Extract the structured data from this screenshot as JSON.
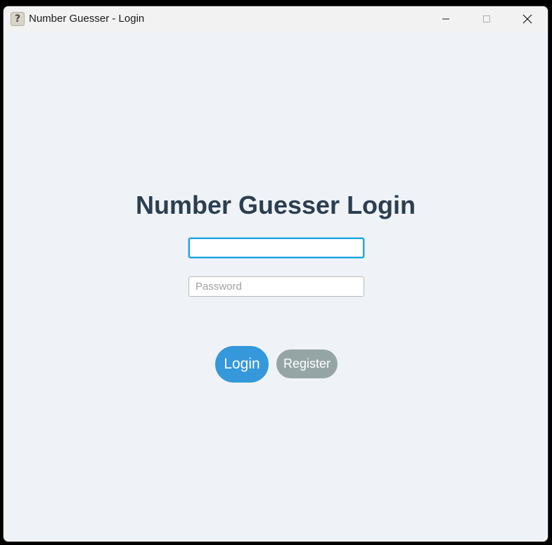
{
  "window": {
    "title": "Number Guesser - Login",
    "icon_glyph": "?",
    "icon_name": "question-mark-app-icon",
    "controls": [
      "minimize-icon",
      "maximize-icon",
      "close-icon"
    ]
  },
  "login": {
    "heading": "Number Guesser Login",
    "username": {
      "value": "",
      "placeholder": ""
    },
    "password": {
      "value": "",
      "placeholder": "Password"
    },
    "login_label": "Login",
    "register_label": "Register"
  },
  "colors": {
    "background": "#eff3f7",
    "heading": "#2c3e50",
    "login_button": "#3498db",
    "register_button": "#95a5a6",
    "focus_border": "#1aa3e0"
  }
}
